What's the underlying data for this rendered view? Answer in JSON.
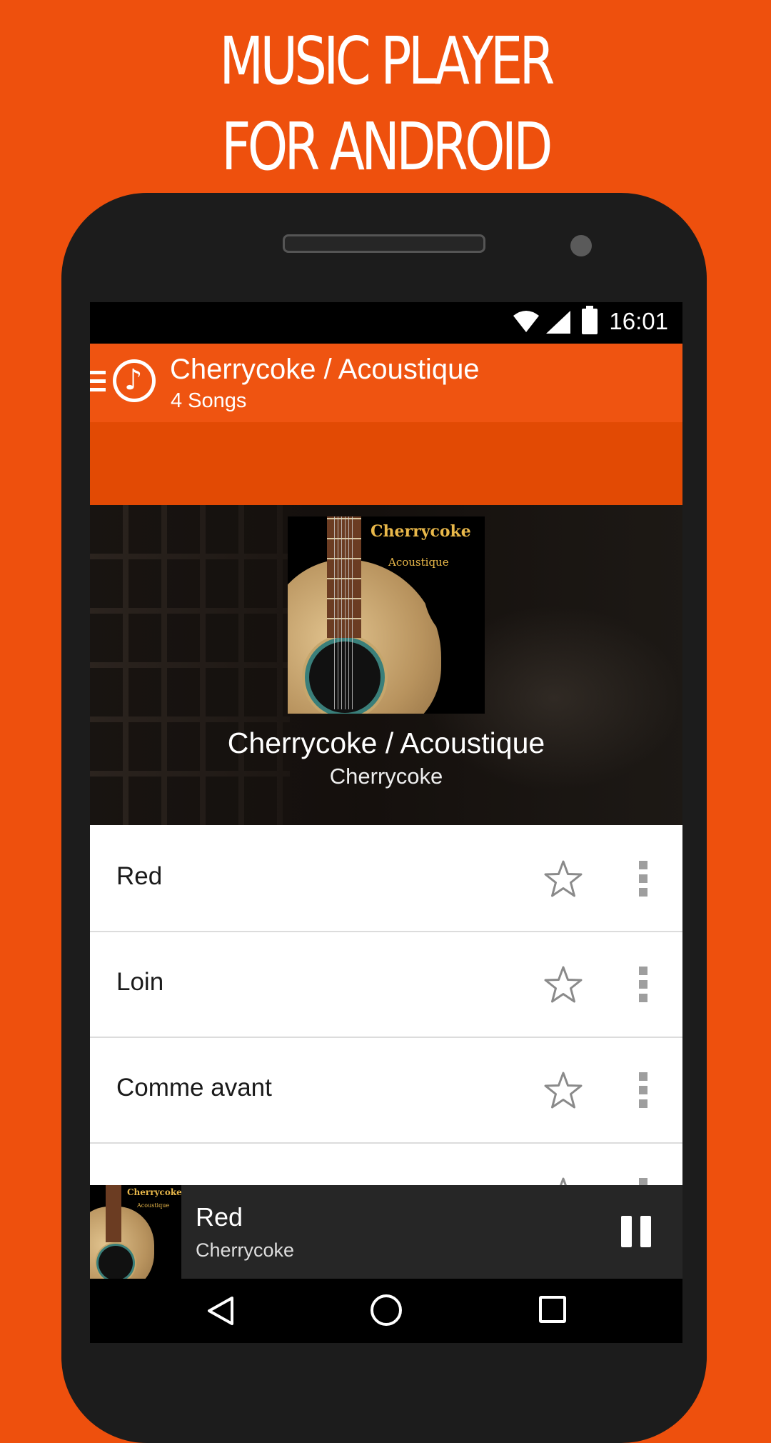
{
  "promo": {
    "line1": "MUSIC PLAYER",
    "line2": "FOR ANDROID"
  },
  "colors": {
    "accent": "#ef5411",
    "accent_dark": "#e24a04",
    "background": "#ee500d"
  },
  "status_bar": {
    "time": "16:01",
    "icons": [
      "wifi-icon",
      "signal-icon",
      "battery-icon"
    ]
  },
  "toolbar": {
    "title": "Cherrycoke / Acoustique",
    "subtitle": "4 Songs",
    "app_icon": "music-note-icon"
  },
  "album": {
    "title": "Cherrycoke / Acoustique",
    "artist": "Cherrycoke",
    "art_band": "Cherrycoke",
    "art_album": "Acoustique"
  },
  "songs": [
    {
      "title": "Red"
    },
    {
      "title": "Loin"
    },
    {
      "title": "Comme avant"
    }
  ],
  "now_playing": {
    "title": "Red",
    "artist": "Cherrycoke",
    "art_band": "Cherrycoke",
    "art_album": "Acoustique",
    "state_icon": "pause-icon"
  },
  "nav": {
    "icons": [
      "back-icon",
      "home-icon",
      "recents-icon"
    ]
  }
}
